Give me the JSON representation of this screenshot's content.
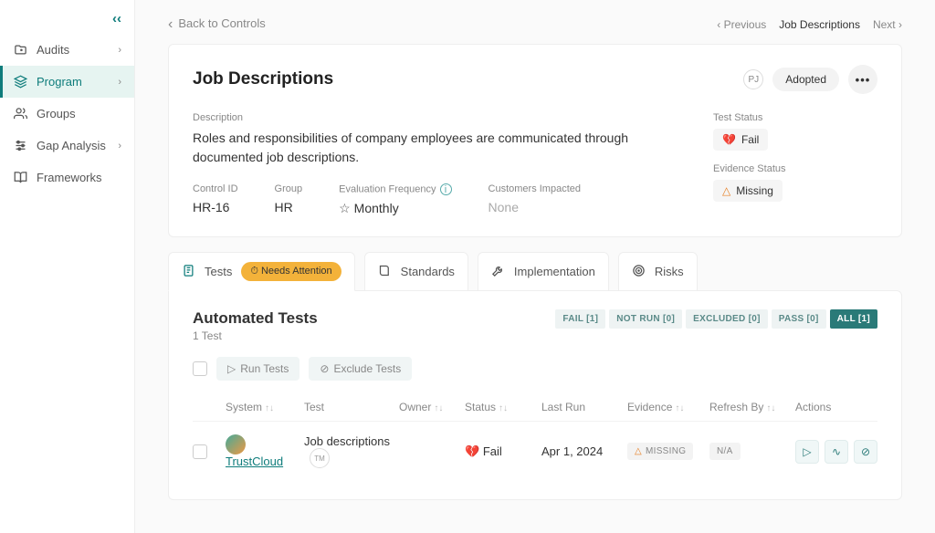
{
  "sidebar": {
    "items": [
      {
        "label": "Audits",
        "icon": "audits"
      },
      {
        "label": "Program",
        "icon": "program"
      },
      {
        "label": "Groups",
        "icon": "groups"
      },
      {
        "label": "Gap Analysis",
        "icon": "gap"
      },
      {
        "label": "Frameworks",
        "icon": "frameworks"
      }
    ]
  },
  "topbar": {
    "back": "Back to Controls",
    "previous": "Previous",
    "current": "Job Descriptions",
    "next": "Next"
  },
  "header": {
    "title": "Job Descriptions",
    "owner_initials": "PJ",
    "status": "Adopted"
  },
  "detail": {
    "desc_label": "Description",
    "description": "Roles and responsibilities of company employees are communicated through documented job descriptions.",
    "control_id_label": "Control ID",
    "control_id": "HR-16",
    "group_label": "Group",
    "group": "HR",
    "freq_label": "Evaluation Frequency",
    "frequency": "Monthly",
    "customers_label": "Customers Impacted",
    "customers": "None",
    "test_status_label": "Test Status",
    "test_status": "Fail",
    "evidence_status_label": "Evidence Status",
    "evidence_status": "Missing"
  },
  "tabs": {
    "tests": "Tests",
    "attention": "Needs Attention",
    "standards": "Standards",
    "implementation": "Implementation",
    "risks": "Risks"
  },
  "tests_section": {
    "title": "Automated Tests",
    "subtitle": "1 Test",
    "run_btn": "Run Tests",
    "exclude_btn": "Exclude Tests",
    "filters": {
      "fail": "FAIL [1]",
      "notrun": "NOT RUN [0]",
      "excluded": "EXCLUDED [0]",
      "pass": "PASS [0]",
      "all": "ALL [1]"
    },
    "columns": {
      "system": "System",
      "test": "Test",
      "owner": "Owner",
      "status": "Status",
      "lastrun": "Last Run",
      "evidence": "Evidence",
      "refresh": "Refresh By",
      "actions": "Actions"
    },
    "row": {
      "system": "TrustCloud",
      "test_name": "Job descriptions",
      "owner_badge": "TM",
      "status": "Fail",
      "last_run": "Apr 1, 2024",
      "evidence": "MISSING",
      "refresh_by": "N/A"
    }
  }
}
